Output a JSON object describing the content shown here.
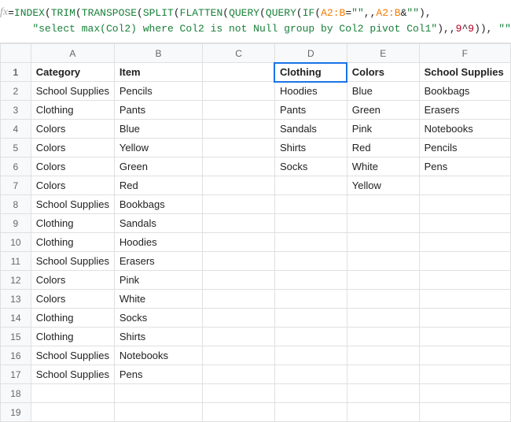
{
  "formula": {
    "line1": {
      "eq": "=",
      "fn1": "INDEX",
      "p1": "(",
      "fn2": "TRIM",
      "p2": "(",
      "fn3": "TRANSPOSE",
      "p3": "(",
      "fn4": "SPLIT",
      "p4": "(",
      "fn5": "FLATTEN",
      "p5": "(",
      "fn6": "QUERY",
      "p6": "(",
      "fn7": "QUERY",
      "p7": "(",
      "fn8": "IF",
      "p8": "(",
      "rng1": "A2:B",
      "mid1": "=",
      "str_empty1": "\"\"",
      "mid2": ",,",
      "rng2": "A2:B",
      "mid3": "&",
      "str_empty2": "\"\"",
      "p9": "),"
    },
    "line2": {
      "indent": "    ",
      "str1": "\"select max(Col2) where Col2 is not Null group by Col2 pivot Col1\"",
      "after1": "),,",
      "num1": "9",
      "caret": "^",
      "num2": "9",
      "after2": ")), ",
      "str_empty3": "\"\"",
      "tail": "))))"
    }
  },
  "fx_label": "fx",
  "columns": [
    "",
    "A",
    "B",
    "C",
    "D",
    "E",
    "F"
  ],
  "active_cell": {
    "row": 1,
    "col": 3
  },
  "rows": [
    {
      "n": "1",
      "cells": [
        "Category",
        "Item",
        "",
        "Clothing",
        "Colors",
        "School Supplies"
      ]
    },
    {
      "n": "2",
      "cells": [
        "School Supplies",
        "Pencils",
        "",
        "Hoodies",
        "Blue",
        "Bookbags"
      ]
    },
    {
      "n": "3",
      "cells": [
        "Clothing",
        "Pants",
        "",
        "Pants",
        "Green",
        "Erasers"
      ]
    },
    {
      "n": "4",
      "cells": [
        "Colors",
        "Blue",
        "",
        "Sandals",
        "Pink",
        "Notebooks"
      ]
    },
    {
      "n": "5",
      "cells": [
        "Colors",
        "Yellow",
        "",
        "Shirts",
        "Red",
        "Pencils"
      ]
    },
    {
      "n": "6",
      "cells": [
        "Colors",
        "Green",
        "",
        "Socks",
        "White",
        "Pens"
      ]
    },
    {
      "n": "7",
      "cells": [
        "Colors",
        "Red",
        "",
        "",
        "Yellow",
        ""
      ]
    },
    {
      "n": "8",
      "cells": [
        "School Supplies",
        "Bookbags",
        "",
        "",
        "",
        ""
      ]
    },
    {
      "n": "9",
      "cells": [
        "Clothing",
        "Sandals",
        "",
        "",
        "",
        ""
      ]
    },
    {
      "n": "10",
      "cells": [
        "Clothing",
        "Hoodies",
        "",
        "",
        "",
        ""
      ]
    },
    {
      "n": "11",
      "cells": [
        "School Supplies",
        "Erasers",
        "",
        "",
        "",
        ""
      ]
    },
    {
      "n": "12",
      "cells": [
        "Colors",
        "Pink",
        "",
        "",
        "",
        ""
      ]
    },
    {
      "n": "13",
      "cells": [
        "Colors",
        "White",
        "",
        "",
        "",
        ""
      ]
    },
    {
      "n": "14",
      "cells": [
        "Clothing",
        "Socks",
        "",
        "",
        "",
        ""
      ]
    },
    {
      "n": "15",
      "cells": [
        "Clothing",
        "Shirts",
        "",
        "",
        "",
        ""
      ]
    },
    {
      "n": "16",
      "cells": [
        "School Supplies",
        "Notebooks",
        "",
        "",
        "",
        ""
      ]
    },
    {
      "n": "17",
      "cells": [
        "School Supplies",
        "Pens",
        "",
        "",
        "",
        ""
      ]
    },
    {
      "n": "18",
      "cells": [
        "",
        "",
        "",
        "",
        "",
        ""
      ]
    },
    {
      "n": "19",
      "cells": [
        "",
        "",
        "",
        "",
        "",
        ""
      ]
    }
  ],
  "col_classes": [
    "col-a",
    "col-b",
    "col-c",
    "col-d",
    "col-e",
    "col-f"
  ]
}
